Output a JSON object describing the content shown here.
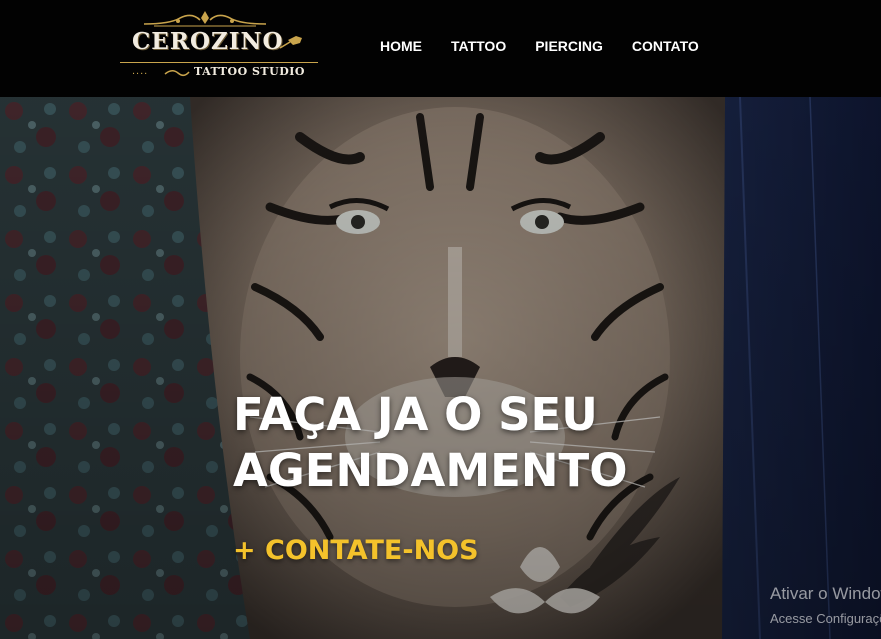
{
  "brand": {
    "name": "CEROZINO",
    "dots": "....",
    "subtitle": "TATTOO STUDIO"
  },
  "nav": {
    "items": [
      {
        "label": "HOME"
      },
      {
        "label": "TATTOO"
      },
      {
        "label": "PIERCING"
      },
      {
        "label": "CONTATO"
      }
    ]
  },
  "hero": {
    "headline_line1": "FAÇA JA O SEU",
    "headline_line2": "AGENDAMENTO",
    "cta": "+ CONTATE-NOS",
    "image": "tiger-tattoo-forearm-photo"
  },
  "watermark": {
    "title": "Ativar o Windows",
    "subtitle": "Acesse Configurações"
  },
  "colors": {
    "header_bg": "#020202",
    "nav_text": "#ffffff",
    "accent_gold": "#c9a44c",
    "cta_yellow": "#f4c22b",
    "headline": "#ffffff"
  }
}
